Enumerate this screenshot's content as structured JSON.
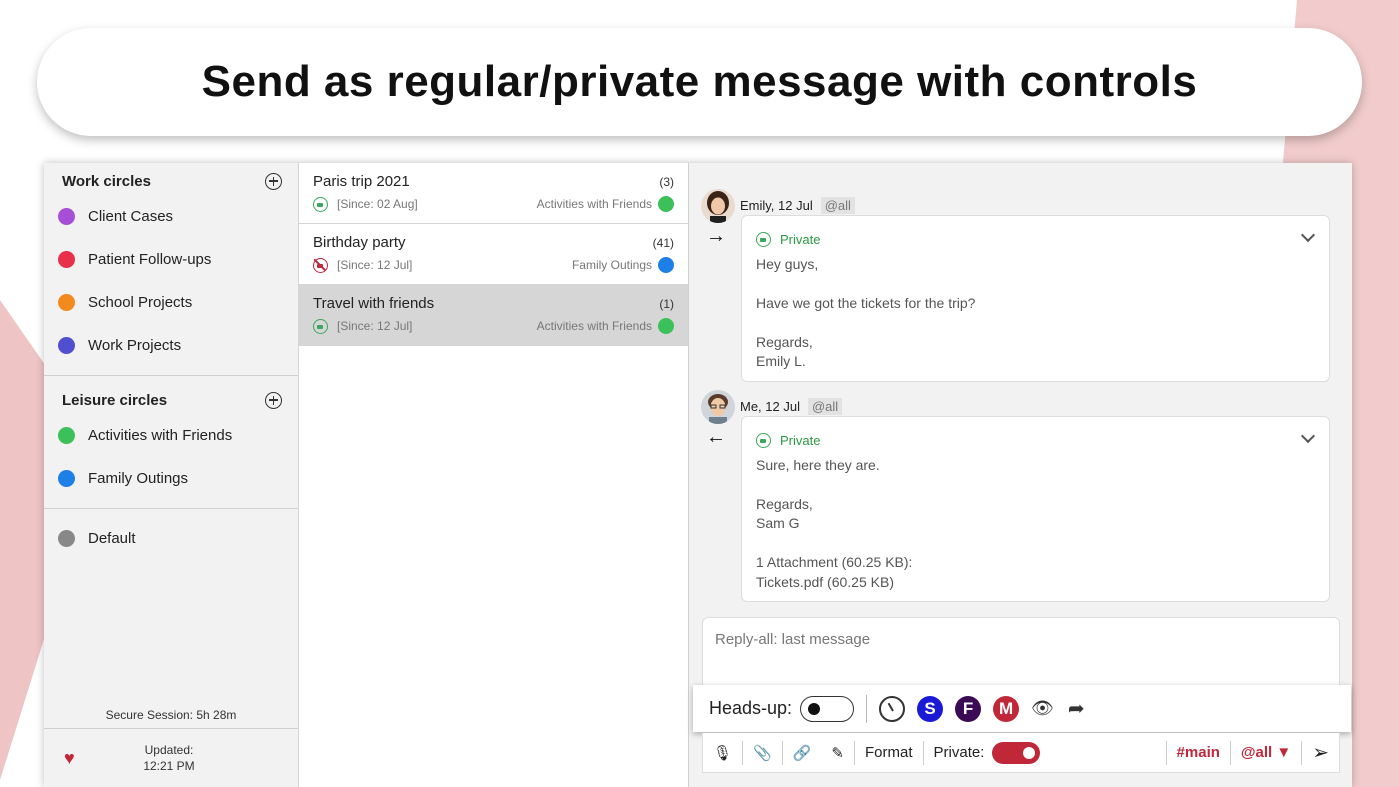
{
  "banner": {
    "title": "Send as regular/private message with controls"
  },
  "colors": {
    "accent": "#c0283a",
    "private": "#2a9a45"
  },
  "sidebar": {
    "work_section": {
      "title": "Work circles",
      "items": [
        {
          "label": "Client Cases",
          "color": "#a64fd6"
        },
        {
          "label": "Patient Follow-ups",
          "color": "#e8304a"
        },
        {
          "label": "School Projects",
          "color": "#f28a1e"
        },
        {
          "label": "Work Projects",
          "color": "#4f4fd0"
        }
      ]
    },
    "leisure_section": {
      "title": "Leisure circles",
      "items": [
        {
          "label": "Activities with Friends",
          "color": "#3cc05a"
        },
        {
          "label": "Family Outings",
          "color": "#1e7fe6"
        }
      ]
    },
    "default_item": {
      "label": "Default",
      "color": "#888888"
    },
    "session": "Secure Session: 5h 28m",
    "updated_label": "Updated:",
    "updated_time": "12:21 PM"
  },
  "conversations": [
    {
      "title": "Paris trip 2021",
      "count": "(3)",
      "since": "[Since: 02 Aug]",
      "circle": "Activities with Friends",
      "circle_color": "#3cc05a",
      "private": true
    },
    {
      "title": "Birthday party",
      "count": "(41)",
      "since": "[Since: 12 Jul]",
      "circle": "Family Outings",
      "circle_color": "#1e7fe6",
      "private": false
    },
    {
      "title": "Travel with friends",
      "count": "(1)",
      "since": "[Since: 12 Jul]",
      "circle": "Activities with Friends",
      "circle_color": "#3cc05a",
      "private": true,
      "selected": true
    }
  ],
  "messages": [
    {
      "sender": "Emily, 12 Jul",
      "tag": "@all",
      "direction": "→",
      "private_label": "Private",
      "lines": [
        "Hey guys,",
        "",
        "Have we got the tickets for the trip?",
        "",
        "Regards,",
        "Emily L."
      ]
    },
    {
      "sender": "Me, 12 Jul",
      "tag": "@all",
      "direction": "←",
      "private_label": "Private",
      "lines": [
        "Sure, here they are.",
        "",
        "Regards,",
        "Sam G",
        "",
        "1 Attachment (60.25 KB):",
        "Tickets.pdf (60.25 KB)"
      ]
    }
  ],
  "reply": {
    "placeholder": "Reply-all: last message"
  },
  "headsup": {
    "label": "Heads-up:",
    "badges": [
      {
        "letter": "S",
        "color": "#1a1ad6"
      },
      {
        "letter": "F",
        "color": "#3a0a55"
      },
      {
        "letter": "M",
        "color": "#c0283a"
      }
    ]
  },
  "toolbar": {
    "format_label": "Format",
    "private_label": "Private:",
    "channel": "#main",
    "mention": "@all ▼"
  }
}
